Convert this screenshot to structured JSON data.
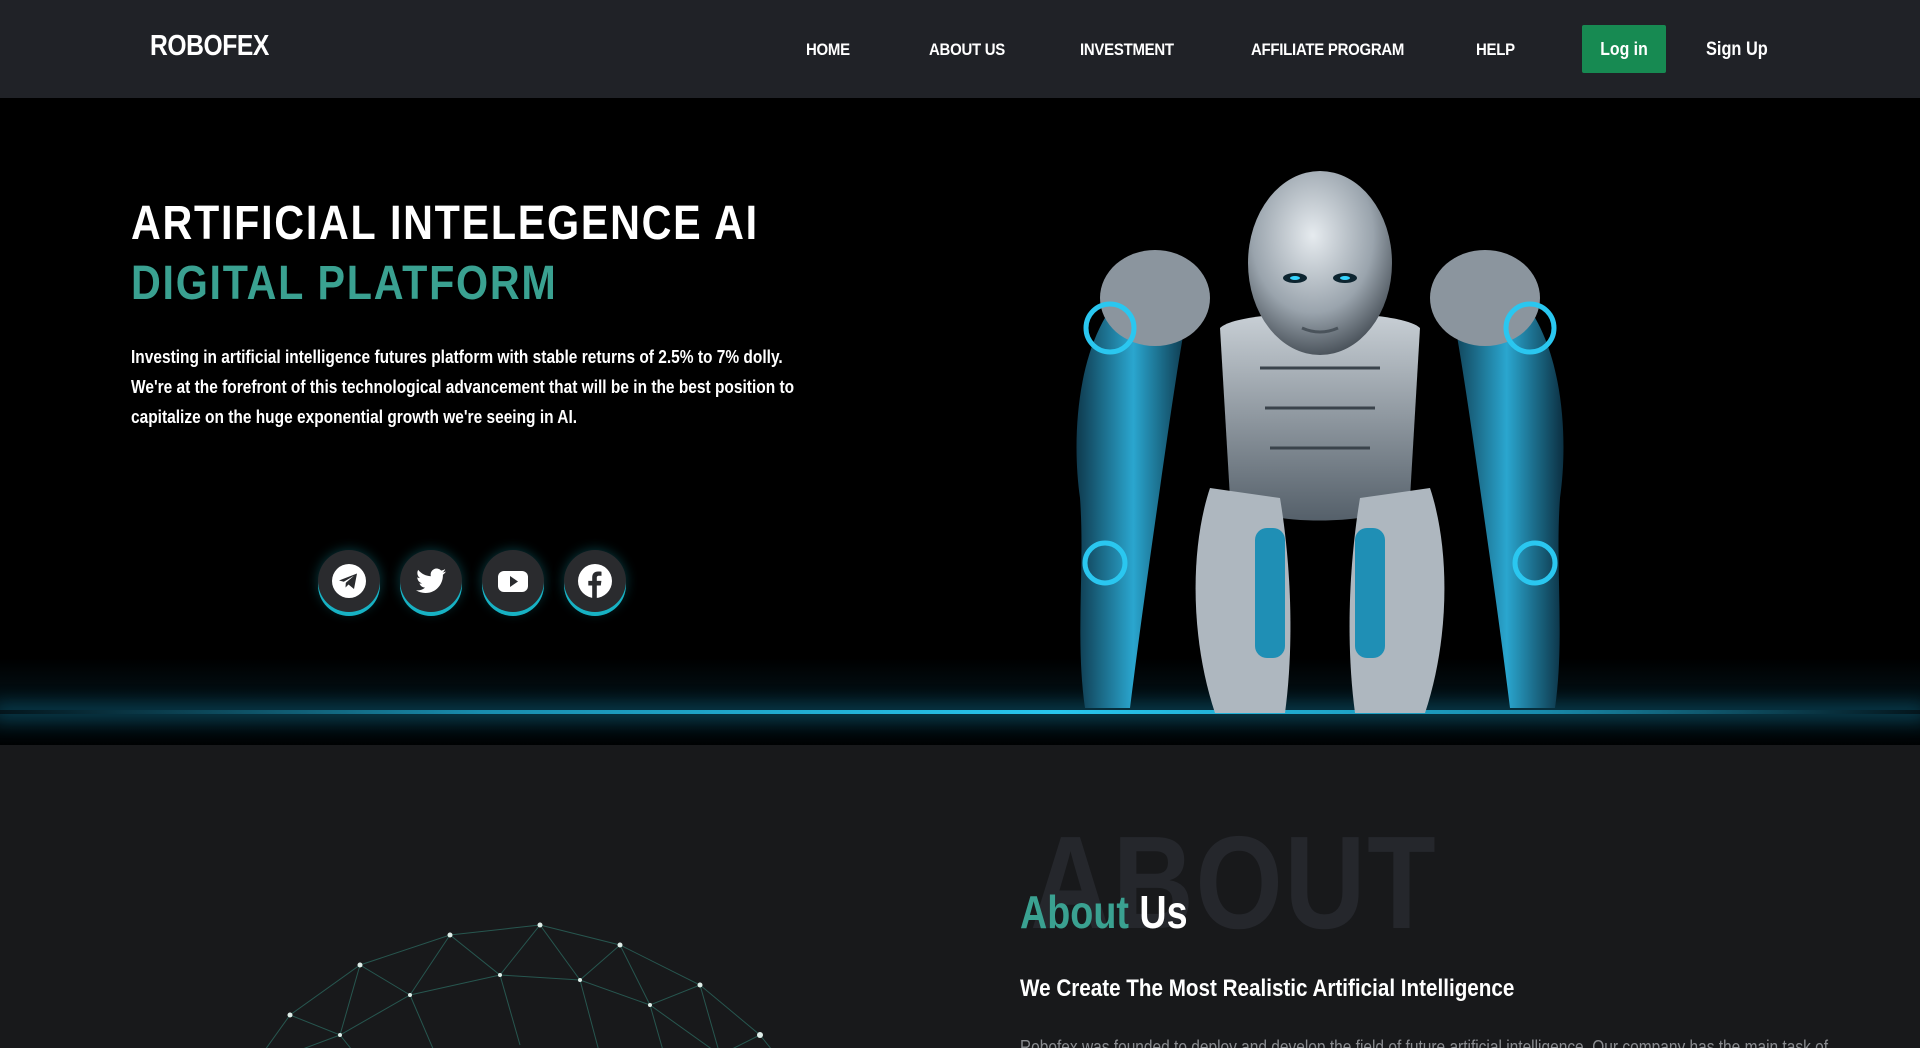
{
  "navbar": {
    "brand": "ROBOFEX",
    "items": [
      {
        "label": "HOME"
      },
      {
        "label": "ABOUT US"
      },
      {
        "label": "INVESTMENT"
      },
      {
        "label": "AFFILIATE PROGRAM"
      },
      {
        "label": "HELP"
      }
    ],
    "login_label": "Log in",
    "signup_label": "Sign Up"
  },
  "hero": {
    "title_line1": "ARTIFICIAL INTELEGENCE AI",
    "title_line2": "DIGITAL PLATFORM",
    "description": "Investing in artificial intelligence futures platform with stable returns of 2.5% to 7% dolly. We're at the forefront of this technological advancement that will be in the best position to capitalize on the huge exponential growth we're seeing in AI.",
    "socials": [
      {
        "icon": "telegram-icon"
      },
      {
        "icon": "twitter-icon"
      },
      {
        "icon": "youtube-icon"
      },
      {
        "icon": "facebook-icon"
      }
    ]
  },
  "about": {
    "bg_word": "ABOUT",
    "title_accent": "About",
    "title_plain": "Us",
    "subtitle": "We Create The Most Realistic Artificial Intelligence",
    "body_partial": "Robofex was founded to deploy and develop the field of future artificial intelligence. Our company has the main task of"
  },
  "colors": {
    "accent": "#3aa191",
    "login_bg": "#178a52",
    "nav_bg": "#202227",
    "hero_bg": "#000000",
    "glow": "#28c6ee"
  }
}
